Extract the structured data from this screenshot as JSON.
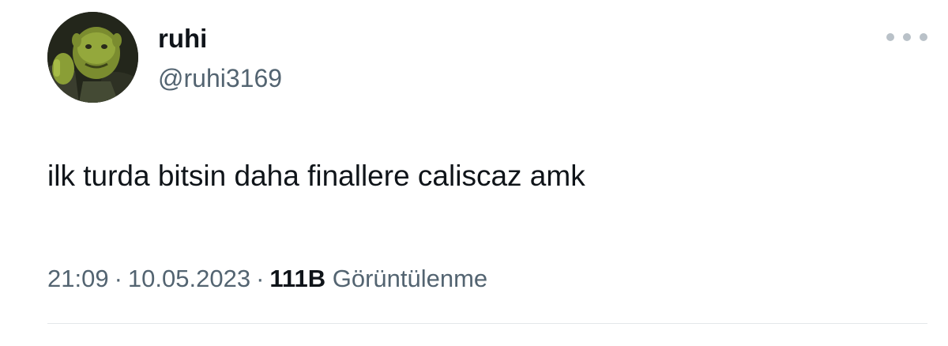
{
  "author": {
    "display_name": "ruhi",
    "handle": "@ruhi3169",
    "avatar_icon": "green-ogre-avatar-icon"
  },
  "menu": {
    "icon": "more-options-icon"
  },
  "tweet": {
    "text": "ilk turda bitsin daha finallere caliscaz amk"
  },
  "meta": {
    "time": "21:09",
    "separator": "·",
    "date": "10.05.2023",
    "views_count": "111B",
    "views_label": "Görüntülenme"
  },
  "colors": {
    "text_primary": "#0f1419",
    "text_secondary": "#536471",
    "divider": "#e3e7ea",
    "more_dots": "#b9c1c8"
  }
}
